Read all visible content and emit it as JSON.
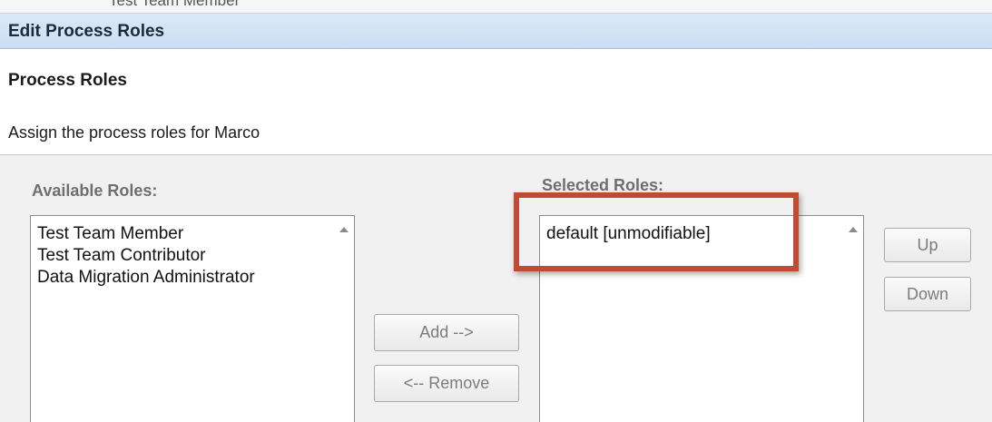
{
  "dialog": {
    "title": "Edit Process Roles",
    "partial_top_text": "Test Team Member"
  },
  "section": {
    "heading": "Process Roles",
    "description": "Assign the process roles for Marco"
  },
  "available": {
    "label": "Available Roles:",
    "items": [
      "Test Team Member",
      "Test Team Contributor",
      "Data Migration Administrator"
    ]
  },
  "selected": {
    "label": "Selected Roles:",
    "items": [
      "default [unmodifiable]"
    ]
  },
  "buttons": {
    "add": "Add -->",
    "remove": "<-- Remove",
    "up": "Up",
    "down": "Down"
  },
  "colors": {
    "highlight_box": "#bf4b35",
    "title_bar": "#d2e3f5"
  }
}
